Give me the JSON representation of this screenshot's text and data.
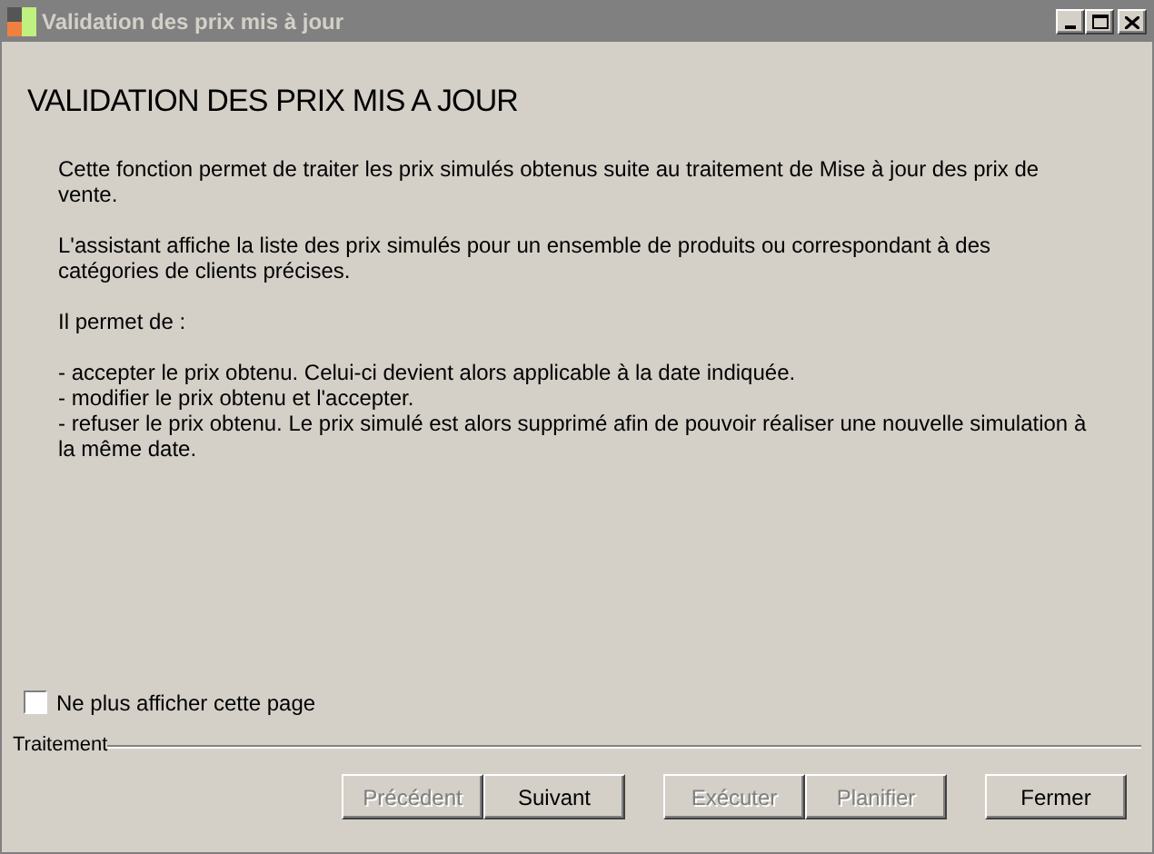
{
  "window": {
    "title": "Validation des prix mis à jour",
    "active": false
  },
  "heading": "VALIDATION DES PRIX MIS A JOUR",
  "paragraphs": [
    {
      "kind": "text",
      "text": "Cette fonction permet de traiter les prix simulés obtenus suite au traitement de Mise à jour des prix de vente."
    },
    {
      "kind": "text",
      "text": "L'assistant affiche la liste des prix simulés pour un ensemble de produits ou correspondant à des catégories de clients précises."
    },
    {
      "kind": "text",
      "text": "Il permet de :"
    },
    {
      "kind": "list",
      "items": [
        "- accepter le prix obtenu. Celui-ci devient alors applicable à la date indiquée.",
        "- modifier le prix obtenu et l'accepter.",
        "- refuser le prix obtenu. Le prix simulé est alors supprimé afin de pouvoir réaliser une nouvelle simulation à la même date."
      ]
    }
  ],
  "checkbox": {
    "label": "Ne plus afficher cette page",
    "checked": false
  },
  "group_label": "Traitement",
  "button_groups": [
    [
      {
        "label": "Précédent",
        "disabled": true
      },
      {
        "label": "Suivant",
        "disabled": false
      }
    ],
    [
      {
        "label": "Exécuter",
        "disabled": true
      },
      {
        "label": "Planifier",
        "disabled": true
      }
    ],
    [
      {
        "label": "Fermer",
        "disabled": false
      }
    ]
  ]
}
